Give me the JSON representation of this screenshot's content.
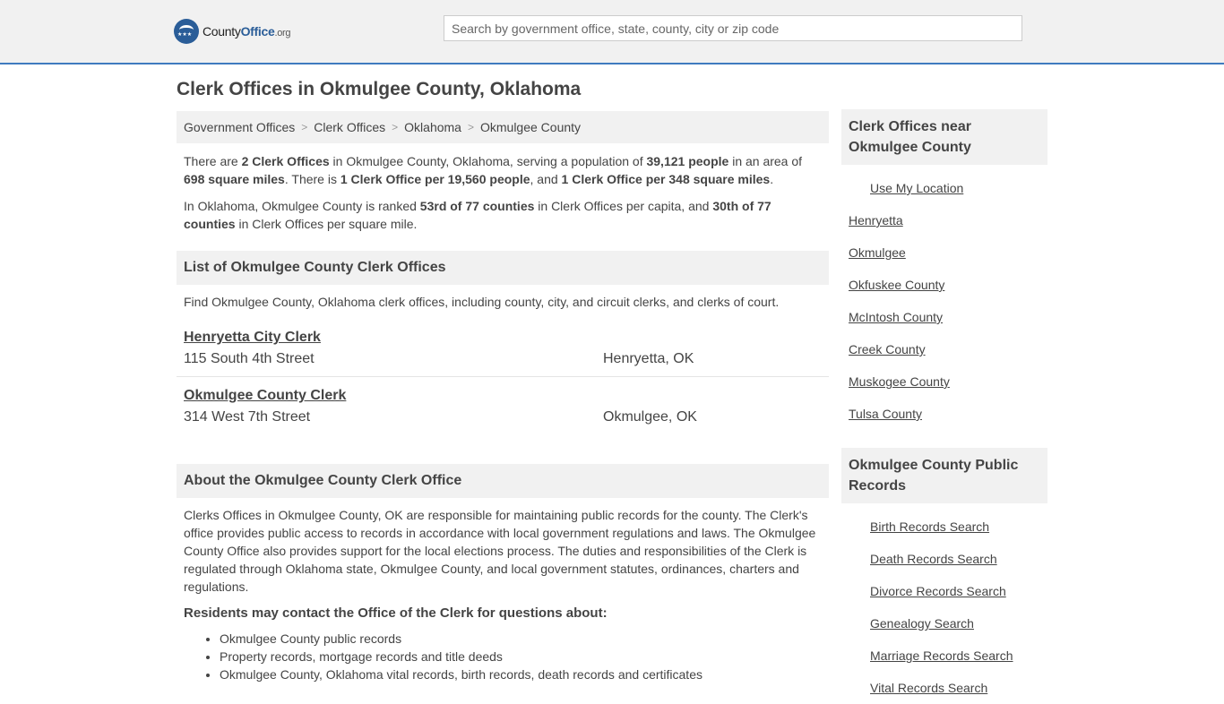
{
  "header": {
    "logo_text": "CountyOffice",
    "logo_o": "Office",
    "logo_county": "County",
    "logo_org": ".org",
    "search_placeholder": "Search by government office, state, county, city or zip code"
  },
  "page_title": "Clerk Offices in Okmulgee County, Oklahoma",
  "breadcrumb": [
    "Government Offices",
    "Clerk Offices",
    "Oklahoma",
    "Okmulgee County"
  ],
  "intro": {
    "p1_a": "There are ",
    "p1_b": "2 Clerk Offices",
    "p1_c": " in Okmulgee County, Oklahoma, serving a population of ",
    "p1_d": "39,121 people",
    "p1_e": " in an area of ",
    "p1_f": "698 square miles",
    "p1_g": ". There is ",
    "p1_h": "1 Clerk Office per 19,560 people",
    "p1_i": ", and ",
    "p1_j": "1 Clerk Office per 348 square miles",
    "p1_k": ".",
    "p2_a": "In Oklahoma, Okmulgee County is ranked ",
    "p2_b": "53rd of 77 counties",
    "p2_c": " in Clerk Offices per capita, and ",
    "p2_d": "30th of 77 counties",
    "p2_e": " in Clerk Offices per square mile."
  },
  "list_section": {
    "title": "List of Okmulgee County Clerk Offices",
    "description": "Find Okmulgee County, Oklahoma clerk offices, including county, city, and circuit clerks, and clerks of court.",
    "offices": [
      {
        "name": "Henryetta City Clerk",
        "street": "115 South 4th Street",
        "city": "Henryetta, OK"
      },
      {
        "name": "Okmulgee County Clerk",
        "street": "314 West 7th Street",
        "city": "Okmulgee, OK"
      }
    ]
  },
  "about_section": {
    "title": "About the Okmulgee County Clerk Office",
    "body": "Clerks Offices in Okmulgee County, OK are responsible for maintaining public records for the county. The Clerk's office provides public access to records in accordance with local government regulations and laws. The Okmulgee County Office also provides support for the local elections process. The duties and responsibilities of the Clerk is regulated through Oklahoma state, Okmulgee County, and local government statutes, ordinances, charters and regulations.",
    "contact_heading": "Residents may contact the Office of the Clerk for questions about:",
    "contact_items": [
      "Okmulgee County public records",
      "Property records, mortgage records and title deeds",
      "Okmulgee County, Oklahoma vital records, birth records, death records and certificates"
    ]
  },
  "sidebar": {
    "nearby_title": "Clerk Offices near Okmulgee County",
    "use_location": "Use My Location",
    "nearby_links": [
      "Henryetta",
      "Okmulgee",
      "Okfuskee County",
      "McIntosh County",
      "Creek County",
      "Muskogee County",
      "Tulsa County"
    ],
    "records_title": "Okmulgee County Public Records",
    "records_links": [
      "Birth Records Search",
      "Death Records Search",
      "Divorce Records Search",
      "Genealogy Search",
      "Marriage Records Search",
      "Vital Records Search"
    ]
  }
}
